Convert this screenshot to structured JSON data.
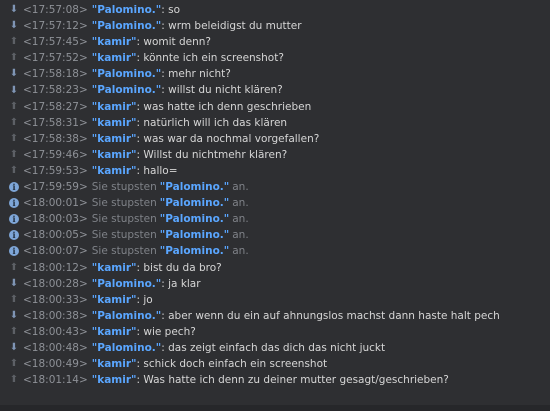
{
  "chat": {
    "lines": [
      {
        "kind": "in",
        "ts": "<17:57:08>",
        "nick": "\"Palomino.\"",
        "text": ": so"
      },
      {
        "kind": "in",
        "ts": "<17:57:12>",
        "nick": "\"Palomino.\"",
        "text": ": wrm beleidigst du mutter"
      },
      {
        "kind": "out",
        "ts": "<17:57:45>",
        "nick": "\"kamir\"",
        "text": ": womit denn?"
      },
      {
        "kind": "out",
        "ts": "<17:57:52>",
        "nick": "\"kamir\"",
        "text": ": könnte ich ein screenshot?"
      },
      {
        "kind": "in",
        "ts": "<17:58:18>",
        "nick": "\"Palomino.\"",
        "text": ": mehr nicht?"
      },
      {
        "kind": "in",
        "ts": "<17:58:23>",
        "nick": "\"Palomino.\"",
        "text": ": willst du nicht klären?"
      },
      {
        "kind": "out",
        "ts": "<17:58:27>",
        "nick": "\"kamir\"",
        "text": ": was hatte ich denn geschrieben"
      },
      {
        "kind": "out",
        "ts": "<17:58:31>",
        "nick": "\"kamir\"",
        "text": ": natürlich will ich das klären"
      },
      {
        "kind": "out",
        "ts": "<17:58:38>",
        "nick": "\"kamir\"",
        "text": ": was war da nochmal vorgefallen?"
      },
      {
        "kind": "out",
        "ts": "<17:59:46>",
        "nick": "\"kamir\"",
        "text": ": Willst du nichtmehr klären?"
      },
      {
        "kind": "out",
        "ts": "<17:59:53>",
        "nick": "\"kamir\"",
        "text": ": hallo="
      },
      {
        "kind": "sys",
        "ts": "<17:59:59>",
        "pre": "Sie stupsten",
        "nick": "\"Palomino.\"",
        "post": "an."
      },
      {
        "kind": "sys",
        "ts": "<18:00:01>",
        "pre": "Sie stupsten",
        "nick": "\"Palomino.\"",
        "post": "an."
      },
      {
        "kind": "sys",
        "ts": "<18:00:03>",
        "pre": "Sie stupsten",
        "nick": "\"Palomino.\"",
        "post": "an."
      },
      {
        "kind": "sys",
        "ts": "<18:00:05>",
        "pre": "Sie stupsten",
        "nick": "\"Palomino.\"",
        "post": "an."
      },
      {
        "kind": "sys",
        "ts": "<18:00:07>",
        "pre": "Sie stupsten",
        "nick": "\"Palomino.\"",
        "post": "an."
      },
      {
        "kind": "out",
        "ts": "<18:00:12>",
        "nick": "\"kamir\"",
        "text": ": bist du da bro?"
      },
      {
        "kind": "in",
        "ts": "<18:00:28>",
        "nick": "\"Palomino.\"",
        "text": ": ja klar"
      },
      {
        "kind": "out",
        "ts": "<18:00:33>",
        "nick": "\"kamir\"",
        "text": ": jo"
      },
      {
        "kind": "in",
        "ts": "<18:00:38>",
        "nick": "\"Palomino.\"",
        "text": ": aber wenn du ein auf ahnungslos machst dann haste halt pech"
      },
      {
        "kind": "out",
        "ts": "<18:00:43>",
        "nick": "\"kamir\"",
        "text": ": wie pech?"
      },
      {
        "kind": "in",
        "ts": "<18:00:48>",
        "nick": "\"Palomino.\"",
        "text": ": das zeigt einfach das dich das nicht juckt"
      },
      {
        "kind": "out",
        "ts": "<18:00:49>",
        "nick": "\"kamir\"",
        "text": ": schick doch einfach ein screenshot"
      },
      {
        "kind": "out",
        "ts": "<18:01:14>",
        "nick": "\"kamir\"",
        "text": ": Was hatte ich denn zu deiner mutter gesagt/geschrieben?"
      }
    ]
  },
  "icons": {
    "in": "arrow-down-icon",
    "out": "arrow-up-icon",
    "sys": "info-icon"
  },
  "colors": {
    "background": "#2e2f32",
    "nick": "#5aa6ff",
    "timestamp": "#8e9197",
    "message": "#d6d6d6",
    "system": "#7f8288"
  }
}
